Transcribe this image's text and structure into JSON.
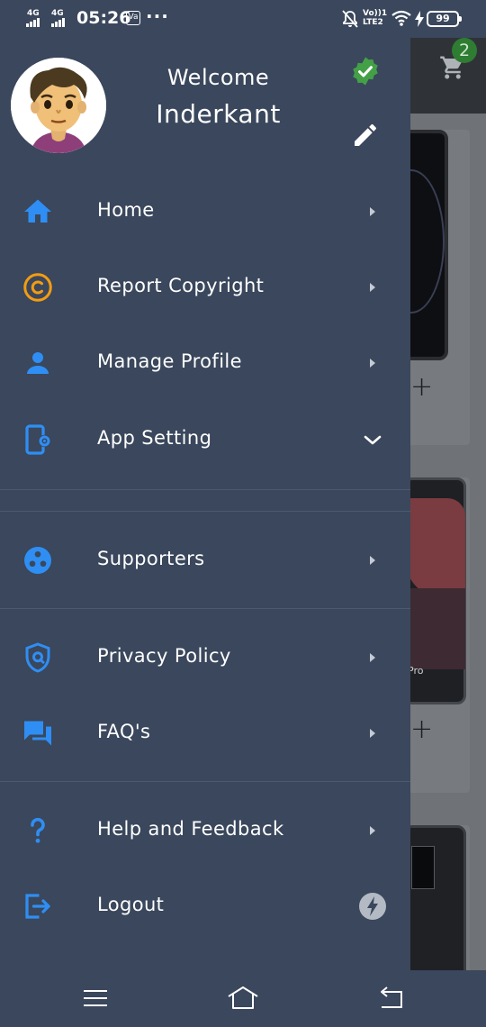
{
  "status_bar": {
    "network_1": "4G",
    "network_2": "4G",
    "time": "05:26",
    "notification_box": "Va",
    "more": "···",
    "volte_line1": "Vo))1",
    "volte_line2": "LTE2",
    "battery": "99"
  },
  "drawer": {
    "welcome": "Welcome",
    "username": "Inderkant",
    "items": [
      {
        "label": "Home",
        "icon": "home-icon",
        "color": "#2f8ef3"
      },
      {
        "label": "Report Copyright",
        "icon": "copyright-icon",
        "color": "#f39c12"
      },
      {
        "label": "Manage Profile",
        "icon": "person-icon",
        "color": "#2f8ef3"
      },
      {
        "label": "App Setting",
        "icon": "phone-settings-icon",
        "color": "#2f8ef3",
        "expanded": true
      },
      {
        "label": "Supporters",
        "icon": "supporters-icon",
        "color": "#2f8ef3"
      },
      {
        "label": "Privacy Policy",
        "icon": "shield-icon",
        "color": "#2f8ef3"
      },
      {
        "label": "FAQ's",
        "icon": "chat-icon",
        "color": "#2f8ef3"
      },
      {
        "label": "Help and Feedback",
        "icon": "help-icon",
        "color": "#2f8ef3"
      },
      {
        "label": "Logout",
        "icon": "logout-icon",
        "color": "#2f8ef3"
      }
    ]
  },
  "background": {
    "cart_count": "2",
    "phone_label": "Pro"
  },
  "colors": {
    "drawer_bg": "#3a475c",
    "accent_blue": "#2f8ef3",
    "accent_orange": "#f39c12",
    "verified_green": "#43a047"
  }
}
